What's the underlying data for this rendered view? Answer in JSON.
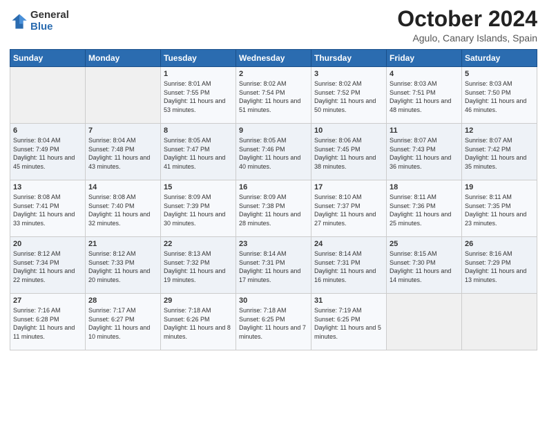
{
  "logo": {
    "general": "General",
    "blue": "Blue"
  },
  "title": "October 2024",
  "subtitle": "Agulo, Canary Islands, Spain",
  "headers": [
    "Sunday",
    "Monday",
    "Tuesday",
    "Wednesday",
    "Thursday",
    "Friday",
    "Saturday"
  ],
  "weeks": [
    [
      {
        "day": "",
        "info": ""
      },
      {
        "day": "",
        "info": ""
      },
      {
        "day": "1",
        "info": "Sunrise: 8:01 AM\nSunset: 7:55 PM\nDaylight: 11 hours and 53 minutes."
      },
      {
        "day": "2",
        "info": "Sunrise: 8:02 AM\nSunset: 7:54 PM\nDaylight: 11 hours and 51 minutes."
      },
      {
        "day": "3",
        "info": "Sunrise: 8:02 AM\nSunset: 7:52 PM\nDaylight: 11 hours and 50 minutes."
      },
      {
        "day": "4",
        "info": "Sunrise: 8:03 AM\nSunset: 7:51 PM\nDaylight: 11 hours and 48 minutes."
      },
      {
        "day": "5",
        "info": "Sunrise: 8:03 AM\nSunset: 7:50 PM\nDaylight: 11 hours and 46 minutes."
      }
    ],
    [
      {
        "day": "6",
        "info": "Sunrise: 8:04 AM\nSunset: 7:49 PM\nDaylight: 11 hours and 45 minutes."
      },
      {
        "day": "7",
        "info": "Sunrise: 8:04 AM\nSunset: 7:48 PM\nDaylight: 11 hours and 43 minutes."
      },
      {
        "day": "8",
        "info": "Sunrise: 8:05 AM\nSunset: 7:47 PM\nDaylight: 11 hours and 41 minutes."
      },
      {
        "day": "9",
        "info": "Sunrise: 8:05 AM\nSunset: 7:46 PM\nDaylight: 11 hours and 40 minutes."
      },
      {
        "day": "10",
        "info": "Sunrise: 8:06 AM\nSunset: 7:45 PM\nDaylight: 11 hours and 38 minutes."
      },
      {
        "day": "11",
        "info": "Sunrise: 8:07 AM\nSunset: 7:43 PM\nDaylight: 11 hours and 36 minutes."
      },
      {
        "day": "12",
        "info": "Sunrise: 8:07 AM\nSunset: 7:42 PM\nDaylight: 11 hours and 35 minutes."
      }
    ],
    [
      {
        "day": "13",
        "info": "Sunrise: 8:08 AM\nSunset: 7:41 PM\nDaylight: 11 hours and 33 minutes."
      },
      {
        "day": "14",
        "info": "Sunrise: 8:08 AM\nSunset: 7:40 PM\nDaylight: 11 hours and 32 minutes."
      },
      {
        "day": "15",
        "info": "Sunrise: 8:09 AM\nSunset: 7:39 PM\nDaylight: 11 hours and 30 minutes."
      },
      {
        "day": "16",
        "info": "Sunrise: 8:09 AM\nSunset: 7:38 PM\nDaylight: 11 hours and 28 minutes."
      },
      {
        "day": "17",
        "info": "Sunrise: 8:10 AM\nSunset: 7:37 PM\nDaylight: 11 hours and 27 minutes."
      },
      {
        "day": "18",
        "info": "Sunrise: 8:11 AM\nSunset: 7:36 PM\nDaylight: 11 hours and 25 minutes."
      },
      {
        "day": "19",
        "info": "Sunrise: 8:11 AM\nSunset: 7:35 PM\nDaylight: 11 hours and 23 minutes."
      }
    ],
    [
      {
        "day": "20",
        "info": "Sunrise: 8:12 AM\nSunset: 7:34 PM\nDaylight: 11 hours and 22 minutes."
      },
      {
        "day": "21",
        "info": "Sunrise: 8:12 AM\nSunset: 7:33 PM\nDaylight: 11 hours and 20 minutes."
      },
      {
        "day": "22",
        "info": "Sunrise: 8:13 AM\nSunset: 7:32 PM\nDaylight: 11 hours and 19 minutes."
      },
      {
        "day": "23",
        "info": "Sunrise: 8:14 AM\nSunset: 7:31 PM\nDaylight: 11 hours and 17 minutes."
      },
      {
        "day": "24",
        "info": "Sunrise: 8:14 AM\nSunset: 7:31 PM\nDaylight: 11 hours and 16 minutes."
      },
      {
        "day": "25",
        "info": "Sunrise: 8:15 AM\nSunset: 7:30 PM\nDaylight: 11 hours and 14 minutes."
      },
      {
        "day": "26",
        "info": "Sunrise: 8:16 AM\nSunset: 7:29 PM\nDaylight: 11 hours and 13 minutes."
      }
    ],
    [
      {
        "day": "27",
        "info": "Sunrise: 7:16 AM\nSunset: 6:28 PM\nDaylight: 11 hours and 11 minutes."
      },
      {
        "day": "28",
        "info": "Sunrise: 7:17 AM\nSunset: 6:27 PM\nDaylight: 11 hours and 10 minutes."
      },
      {
        "day": "29",
        "info": "Sunrise: 7:18 AM\nSunset: 6:26 PM\nDaylight: 11 hours and 8 minutes."
      },
      {
        "day": "30",
        "info": "Sunrise: 7:18 AM\nSunset: 6:25 PM\nDaylight: 11 hours and 7 minutes."
      },
      {
        "day": "31",
        "info": "Sunrise: 7:19 AM\nSunset: 6:25 PM\nDaylight: 11 hours and 5 minutes."
      },
      {
        "day": "",
        "info": ""
      },
      {
        "day": "",
        "info": ""
      }
    ]
  ]
}
